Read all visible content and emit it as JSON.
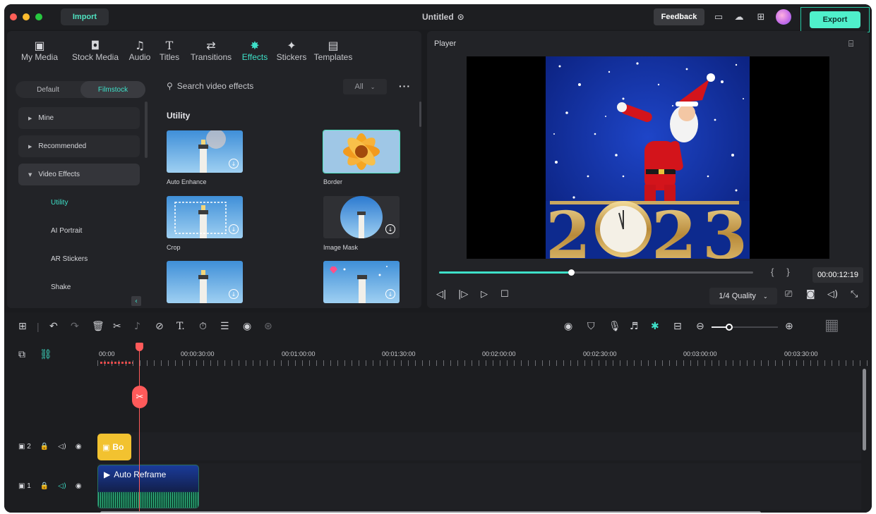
{
  "titlebar": {
    "import_label": "Import",
    "doc_title": "Untitled",
    "feedback_label": "Feedback",
    "export_label": "Export"
  },
  "library": {
    "tabs": [
      {
        "label": "My Media",
        "icon": "media-icon"
      },
      {
        "label": "Stock Media",
        "icon": "stock-media-icon"
      },
      {
        "label": "Audio",
        "icon": "music-note-icon"
      },
      {
        "label": "Titles",
        "icon": "text-t-icon"
      },
      {
        "label": "Transitions",
        "icon": "transitions-icon"
      },
      {
        "label": "Effects",
        "icon": "sparkle-icon",
        "active": true
      },
      {
        "label": "Stickers",
        "icon": "sticker-icon"
      },
      {
        "label": "Templates",
        "icon": "templates-icon"
      }
    ],
    "segment": {
      "default_label": "Default",
      "filmstock_label": "Filmstock"
    },
    "sidebar": [
      {
        "label": "Mine"
      },
      {
        "label": "Recommended"
      },
      {
        "label": "Video Effects"
      },
      {
        "label": "Utility"
      },
      {
        "label": "AI Portrait"
      },
      {
        "label": "AR Stickers"
      },
      {
        "label": "Shake"
      }
    ],
    "search_placeholder": "Search video effects",
    "filter_value": "All",
    "section_title": "Utility",
    "effects": [
      {
        "label": "Auto Enhance"
      },
      {
        "label": "Border"
      },
      {
        "label": "Crop"
      },
      {
        "label": "Image Mask"
      }
    ]
  },
  "player": {
    "title": "Player",
    "timecode": "00:00:12:19",
    "quality": "1/4 Quality",
    "progress": 0.42
  },
  "timeline": {
    "ruler": [
      "00:00",
      "00:00:30:00",
      "00:01:00:00",
      "00:01:30:00",
      "00:02:00:00",
      "00:02:30:00",
      "00:03:00:00",
      "00:03:30:00"
    ],
    "tracks": [
      {
        "label": "2"
      },
      {
        "label": "1"
      }
    ],
    "clip_yellow_label": "Bo",
    "clip_video_label": "Auto Reframe"
  },
  "colors": {
    "accent": "#3ee0c8",
    "export": "#4ff0cb",
    "playhead": "#ff5a5a",
    "clip_yellow": "#f2c230"
  }
}
